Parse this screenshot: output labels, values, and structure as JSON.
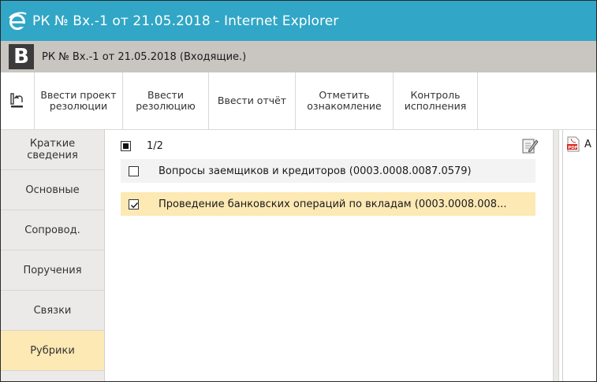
{
  "window": {
    "title": "РК № Вх.-1 от 21.05.2018 - Internet Explorer",
    "colors": {
      "titlebar": "#31a6c6",
      "header": "#c9c6c2",
      "accent": "#fde9b4"
    }
  },
  "doc": {
    "badge": "В",
    "title": "РК № Вх.-1 от 21.05.2018 (Входящие.)"
  },
  "toolbar": {
    "back_icon": "return-document-icon",
    "buttons": [
      {
        "label": "Ввести проект\nрезолюции"
      },
      {
        "label": "Ввести\nрезолюцию"
      },
      {
        "label": "Ввести отчёт"
      },
      {
        "label": "Отметить\nознакомление"
      },
      {
        "label": "Контроль\nисполнения"
      }
    ]
  },
  "sidebar": {
    "items": [
      {
        "label": "Краткие\nсведения"
      },
      {
        "label": "Основные"
      },
      {
        "label": "Сопровод."
      },
      {
        "label": "Поручения"
      },
      {
        "label": "Связки"
      },
      {
        "label": "Рубрики",
        "active": true
      }
    ]
  },
  "rubrics": {
    "counter": "1/2",
    "rows": [
      {
        "text": "Вопросы заемщиков и кредиторов (0003.0008.0087.0579)",
        "checked": false
      },
      {
        "text": "Проведение банковских операций по вкладам (0003.0008.008...",
        "checked": true
      }
    ]
  },
  "attachments": {
    "first_label": "A",
    "icon": "pdf-file-icon"
  }
}
